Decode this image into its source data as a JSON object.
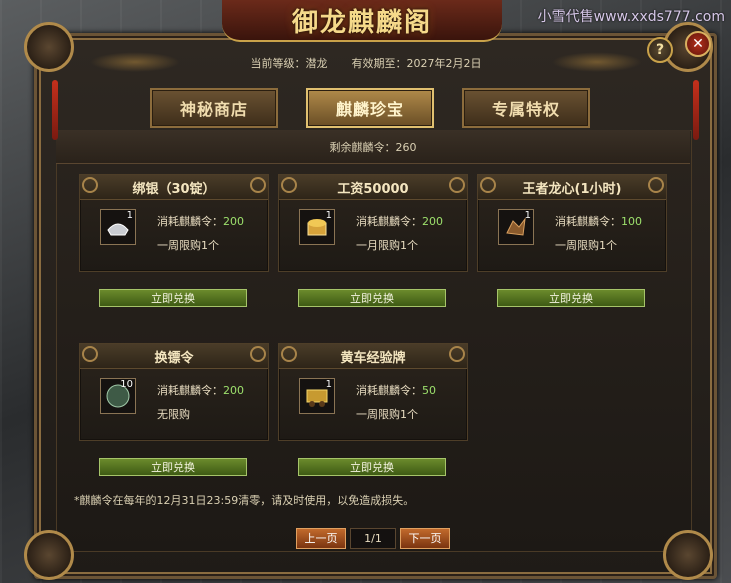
{
  "watermark": "小雪代售www.xxds777.com",
  "window": {
    "title": "御龙麒麟阁"
  },
  "info": {
    "level_label": "当前等级：潜龙",
    "expire_label": "有效期至：2027年2月2日"
  },
  "tabs": [
    {
      "label": "神秘商店",
      "active": false
    },
    {
      "label": "麒麟珍宝",
      "active": true
    },
    {
      "label": "专属特权",
      "active": false
    }
  ],
  "remaining": "剩余麒麟令：260",
  "cost_prefix": "消耗麒麟令：",
  "exchange_label": "立即兑换",
  "items": [
    {
      "name": "绑银（30锭）",
      "qty": "1",
      "cost": "200",
      "limit": "一周限购1个",
      "icon": "silver-ingot-icon"
    },
    {
      "name": "工资50000",
      "qty": "1",
      "cost": "200",
      "limit": "一月限购1个",
      "icon": "gold-wage-icon"
    },
    {
      "name": "王者龙心(1小时)",
      "qty": "1",
      "cost": "100",
      "limit": "一周限购1个",
      "icon": "dragon-heart-icon"
    },
    {
      "name": "换镖令",
      "qty": "10",
      "cost": "200",
      "limit": "无限购",
      "icon": "escort-token-icon"
    },
    {
      "name": "黄车经验牌",
      "qty": "1",
      "cost": "50",
      "limit": "一周限购1个",
      "icon": "yellow-cart-exp-icon"
    }
  ],
  "note": "*麒麟令在每年的12月31日23:59清零，请及时使用，以免造成损失。",
  "pager": {
    "prev": "上一页",
    "page": "1/1",
    "next": "下一页"
  },
  "buttons": {
    "help": "?",
    "close": "✕"
  }
}
